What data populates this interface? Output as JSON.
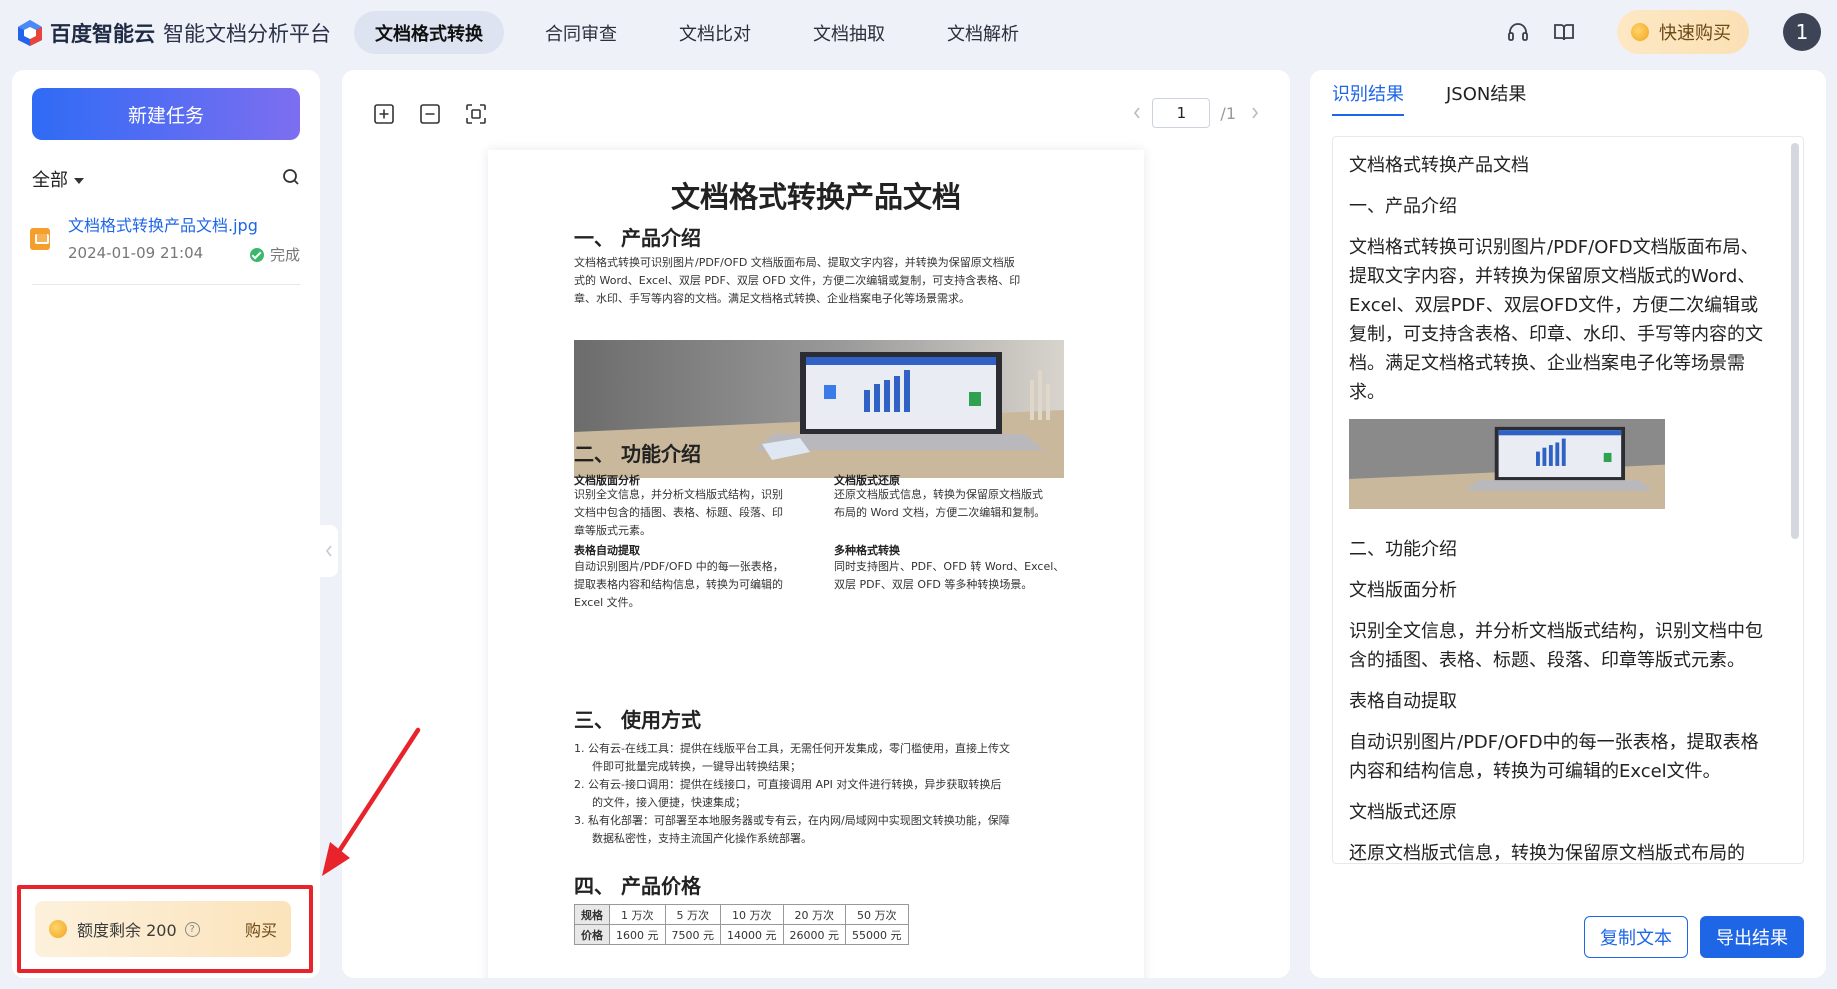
{
  "brand": {
    "name": "百度智能云",
    "product": "智能文档分析平台"
  },
  "nav": {
    "tabs": [
      {
        "label": "文档格式转换",
        "active": true
      },
      {
        "label": "合同审查",
        "active": false
      },
      {
        "label": "文档比对",
        "active": false
      },
      {
        "label": "文档抽取",
        "active": false
      },
      {
        "label": "文档解析",
        "active": false
      }
    ],
    "buy_label": "快速购买",
    "avatar_label": "1"
  },
  "left": {
    "new_task_label": "新建任务",
    "filter_label": "全部",
    "file": {
      "name": "文档格式转换产品文档.jpg",
      "date": "2024-01-09 21:04",
      "status": "完成"
    },
    "quota": {
      "text": "额度剩余 200",
      "buy_label": "购买"
    }
  },
  "viewer": {
    "page_current": "1",
    "page_total": "/1",
    "doc": {
      "title": "文档格式转换产品文档",
      "s1_title": "一、 产品介绍",
      "s1_l1": "文档格式转换可识别图片/PDF/OFD 文档版面布局、提取文字内容，并转换为保留原文档版",
      "s1_l2": "式的 Word、Excel、双层 PDF、双层 OFD 文件，方便二次编辑或复制，可支持含表格、印",
      "s1_l3": "章、水印、手写等内容的文档。满足文档格式转换、企业档案电子化等场景需求。",
      "s2_title": "二、 功能介绍",
      "f1_title": "文档版面分析",
      "f1_l1": "识别全文信息，并分析文档版式结构，识别",
      "f1_l2": "文档中包含的插图、表格、标题、段落、印",
      "f1_l3": "章等版式元素。",
      "f2_title": "文档版式还原",
      "f2_l1": "还原文档版式信息，转换为保留原文档版式",
      "f2_l2": "布局的 Word 文档，方便二次编辑和复制。",
      "f3_title": "表格自动提取",
      "f3_l1": "自动识别图片/PDF/OFD 中的每一张表格，",
      "f3_l2": "提取表格内容和结构信息，转换为可编辑的",
      "f3_l3": "Excel 文件。",
      "f4_title": "多种格式转换",
      "f4_l1": "同时支持图片、PDF、OFD 转 Word、Excel、",
      "f4_l2": "双层 PDF、双层 OFD 等多种转换场景。",
      "s3_title": "三、 使用方式",
      "u1_l1": "1.  公有云-在线工具：提供在线版平台工具，无需任何开发集成，零门槛使用，直接上传文",
      "u1_l2": "件即可批量完成转换，一键导出转换结果；",
      "u2_l1": "2.  公有云-接口调用：提供在线接口，可直接调用 API 对文件进行转换，异步获取转换后",
      "u2_l2": "的文件，接入便捷，快速集成；",
      "u3_l1": "3.  私有化部署：可部署至本地服务器或专有云，在内网/局域网中实现图文转换功能，保障",
      "u3_l2": "数据私密性，支持主流国产化操作系统部署。",
      "s4_title": "四、 产品价格",
      "price_table": {
        "row1": [
          "规格",
          "1 万次",
          "5 万次",
          "10 万次",
          "20 万次",
          "50 万次"
        ],
        "row2": [
          "价格",
          "1600 元",
          "7500 元",
          "14000 元",
          "26000 元",
          "55000 元"
        ]
      }
    }
  },
  "result": {
    "tabs": [
      {
        "label": "识别结果",
        "active": true
      },
      {
        "label": "JSON结果",
        "active": false
      }
    ],
    "p1": "文档格式转换产品文档",
    "p2": "一、产品介绍",
    "p3": "文档格式转换可识别图片/PDF/OFD文档版面布局、提取文字内容，并转换为保留原文档版式的Word、Excel、双层PDF、双层OFD文件，方便二次编辑或复制，可支持含表格、印章、水印、手写等内容的文档。满足文档格式转换、企业档案电子化等场景需求。",
    "p4": "二、功能介绍",
    "p5": "文档版面分析",
    "p6": "识别全文信息，并分析文档版式结构，识别文档中包含的插图、表格、标题、段落、印章等版式元素。",
    "p7": "表格自动提取",
    "p8": "自动识别图片/PDF/OFD中的每一张表格，提取表格内容和结构信息，转换为可编辑的Excel文件。",
    "p9": "文档版式还原",
    "p10": "还原文档版式信息，转换为保留原文档版式布局的Word文档，方便二次编辑和复制。",
    "copy_label": "复制文本",
    "export_label": "导出结果"
  },
  "colors": {
    "accent": "#1f66e6",
    "annotation": "#e8232c",
    "page_bg": "#eef1f8"
  }
}
